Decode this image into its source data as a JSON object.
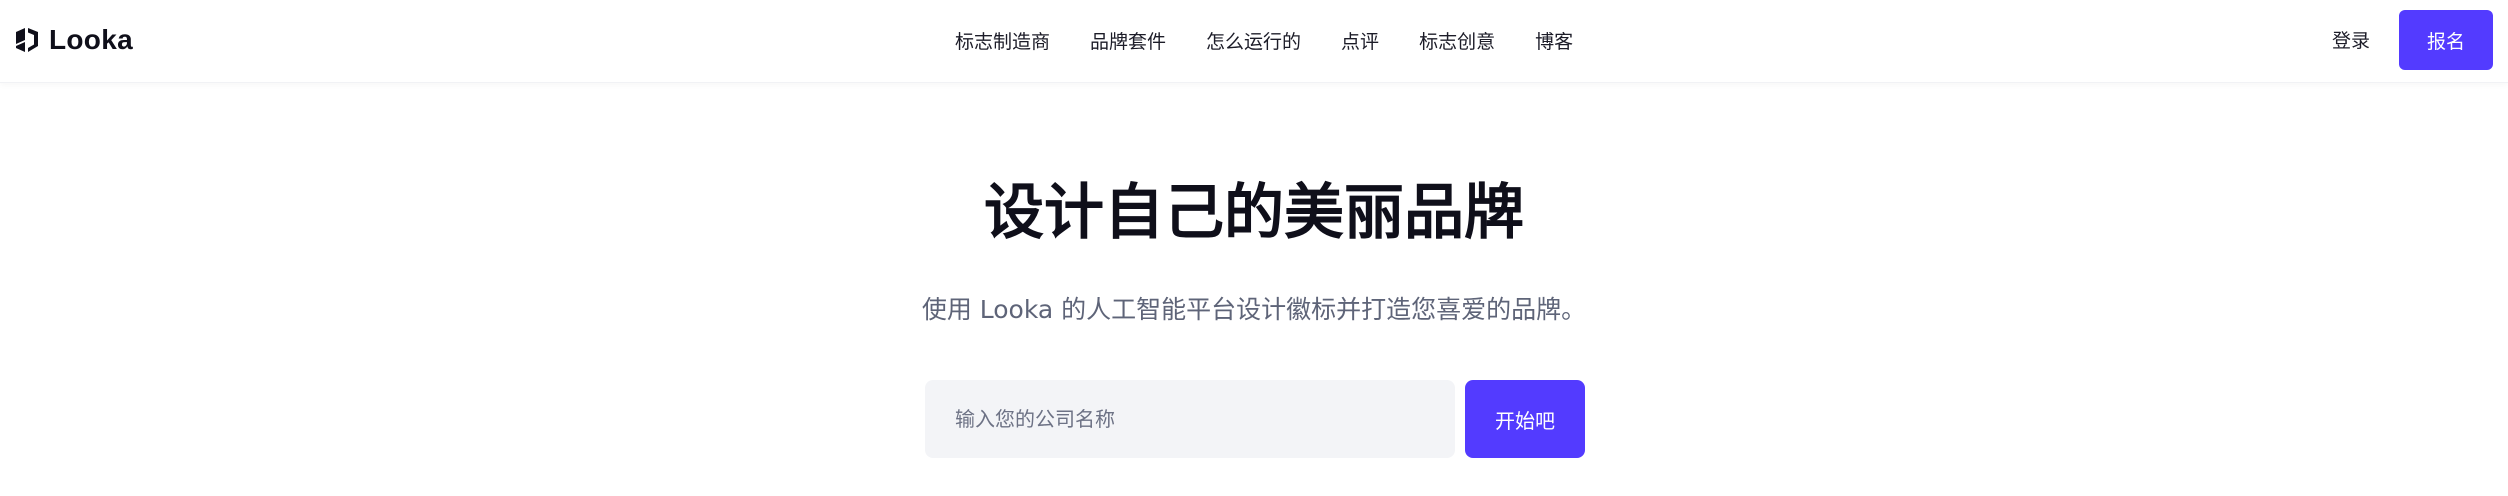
{
  "header": {
    "logo_icon": "looka-logo-icon",
    "logo_text": "Looka",
    "nav": [
      {
        "label": "标志制造商"
      },
      {
        "label": "品牌套件"
      },
      {
        "label": "怎么运行的"
      },
      {
        "label": "点评"
      },
      {
        "label": "标志创意"
      },
      {
        "label": "博客"
      }
    ],
    "login_label": "登录",
    "signup_label": "报名"
  },
  "hero": {
    "title": "设计自己的美丽品牌",
    "subtitle": "使用 Looka 的人工智能平台设计徽标并打造您喜爱的品牌。",
    "input_placeholder": "输入您的公司名称",
    "input_value": "",
    "start_label": "开始吧"
  },
  "colors": {
    "accent": "#533bff",
    "input_bg": "#f3f4f7",
    "subtitle": "#5e6478",
    "text": "#0f0f1a"
  }
}
